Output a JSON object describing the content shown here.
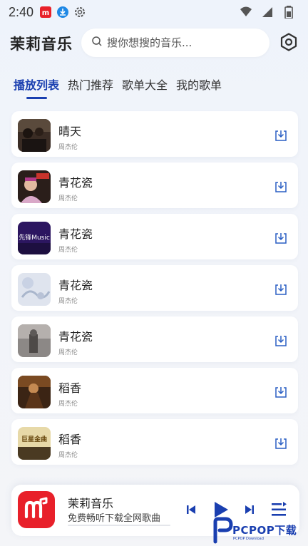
{
  "status_bar": {
    "time": "2:40",
    "icons": [
      "app-notification-icon",
      "download-notification-icon",
      "settings-notification-icon",
      "wifi-icon",
      "signal-icon",
      "battery-icon"
    ]
  },
  "header": {
    "app_title": "茉莉音乐",
    "search_placeholder": "搜你想搜的音乐...",
    "settings_icon": "hexagon-gear-icon"
  },
  "tabs": [
    {
      "label": "播放列表",
      "active": true
    },
    {
      "label": "热门推荐",
      "active": false
    },
    {
      "label": "歌单大全",
      "active": false
    },
    {
      "label": "我的歌单",
      "active": false
    }
  ],
  "songs": [
    {
      "title": "晴天",
      "artist": "周杰伦"
    },
    {
      "title": "青花瓷",
      "artist": "周杰伦"
    },
    {
      "title": "青花瓷",
      "artist": "周杰伦"
    },
    {
      "title": "青花瓷",
      "artist": "周杰伦"
    },
    {
      "title": "青花瓷",
      "artist": "周杰伦"
    },
    {
      "title": "稻香",
      "artist": "周杰伦"
    },
    {
      "title": "稻香",
      "artist": "周杰伦"
    }
  ],
  "cover_texts": {
    "cover3": "先锋Music",
    "cover7": "巨星金曲"
  },
  "player": {
    "title": "茉莉音乐",
    "subtitle": "免费畅听下载全网歌曲",
    "progress": 0.0
  },
  "watermark": {
    "text": "PCPOP下载",
    "sub": "PCPOP Download"
  },
  "colors": {
    "accent": "#1a3fb0",
    "brand_red": "#e8202a",
    "download_icon": "#2a5fc4"
  }
}
